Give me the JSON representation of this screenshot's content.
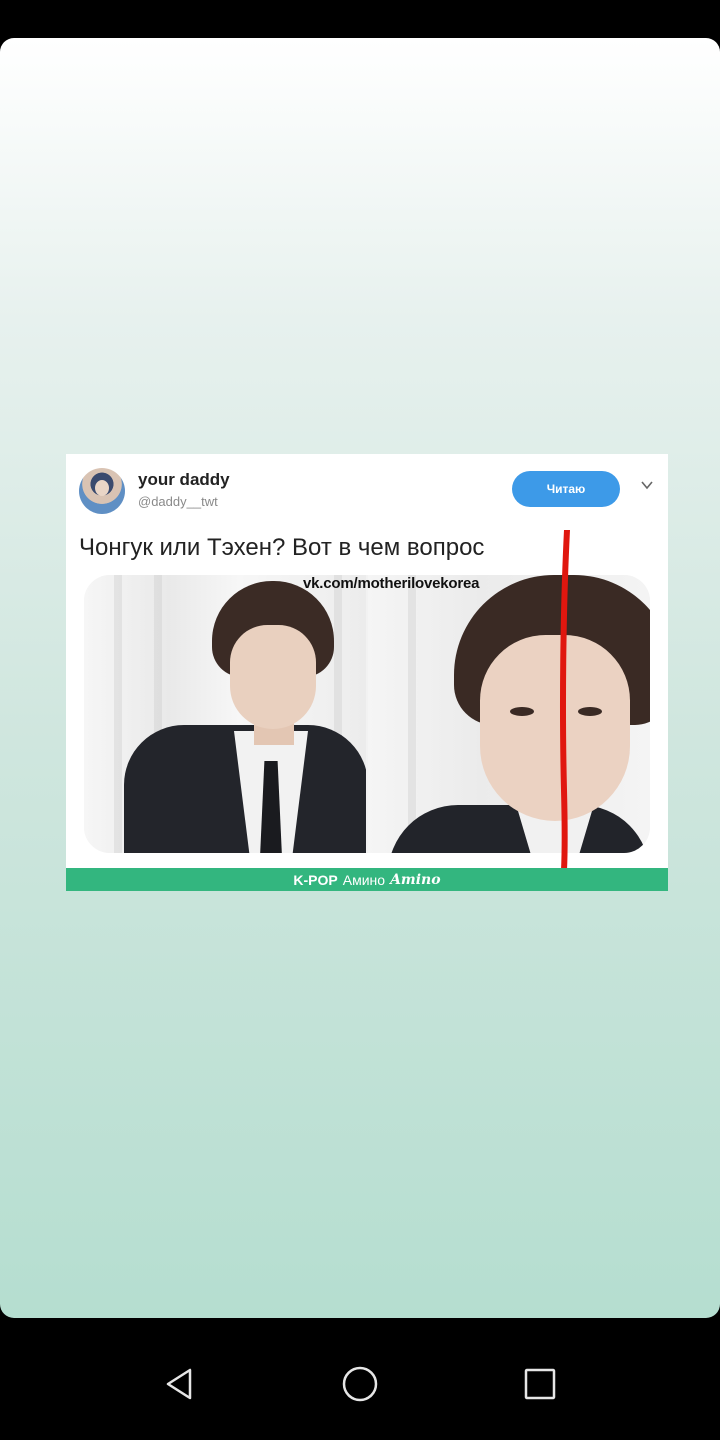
{
  "tweet": {
    "user_name": "your daddy",
    "user_handle": "@daddy__twt",
    "follow_label": "Читаю",
    "text": "Чонгук или Тэхен? Вот в чем вопрос"
  },
  "image": {
    "watermark": "vk.com/motherilovekorea"
  },
  "footer": {
    "kpop": "K-POP",
    "amino_ru": "Амино",
    "amino_logo": "Amino"
  },
  "colors": {
    "follow_button": "#3d9ae8",
    "footer_bar": "#33b67f",
    "red_line": "#e0170f",
    "background_top": "#ffffff",
    "background_bottom": "#b5ded0"
  },
  "navigation": {
    "back_icon": "triangle-back-icon",
    "home_icon": "circle-home-icon",
    "recents_icon": "square-recents-icon"
  }
}
